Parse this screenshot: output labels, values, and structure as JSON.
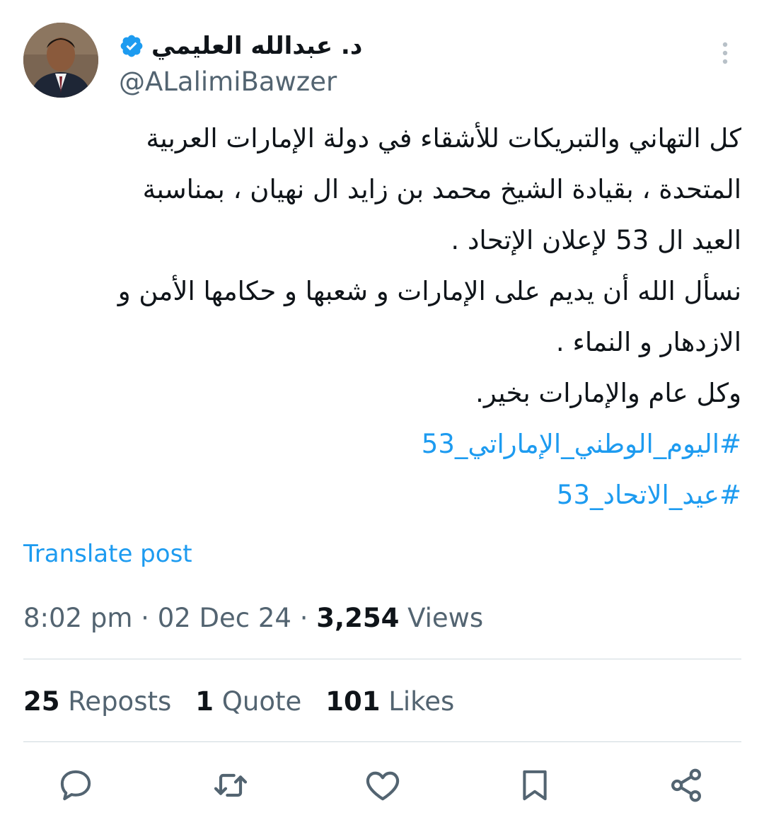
{
  "author": {
    "display_name": "د. عبدالله العليمي",
    "handle": "@ALalimiBawzer",
    "verified": true
  },
  "tweet": {
    "lines": [
      "كل التهاني والتبريكات للأشقاء في دولة الإمارات العربية",
      "المتحدة ، بقيادة الشيخ محمد بن زايد ال نهيان ، بمناسبة",
      "العيد ال 53 لإعلان الإتحاد .",
      "نسأل الله أن يديم على الإمارات و شعبها و حكامها الأمن و",
      "الازدهار و النماء .",
      "وكل عام والإمارات بخير."
    ],
    "hashtags": [
      "#اليوم_الوطني_الإماراتي_53",
      "#عيد_الاتحاد_53"
    ]
  },
  "translate_label": "Translate post",
  "meta": {
    "time": "8:02 pm",
    "separator": "·",
    "date": "02 Dec 24",
    "views_count": "3,254",
    "views_label": "Views"
  },
  "stats": {
    "reposts_count": "25",
    "reposts_label": "Reposts",
    "quotes_count": "1",
    "quotes_label": "Quote",
    "likes_count": "101",
    "likes_label": "Likes"
  },
  "icons": {
    "reply": "reply-icon",
    "repost": "repost-icon",
    "like": "like-icon",
    "bookmark": "bookmark-icon",
    "share": "share-icon",
    "more": "more-vertical-icon",
    "verified": "verified-badge-icon"
  },
  "colors": {
    "link": "#1d9bf0",
    "text": "#0f1419",
    "secondary": "#536471",
    "divider": "#cfd9de"
  }
}
